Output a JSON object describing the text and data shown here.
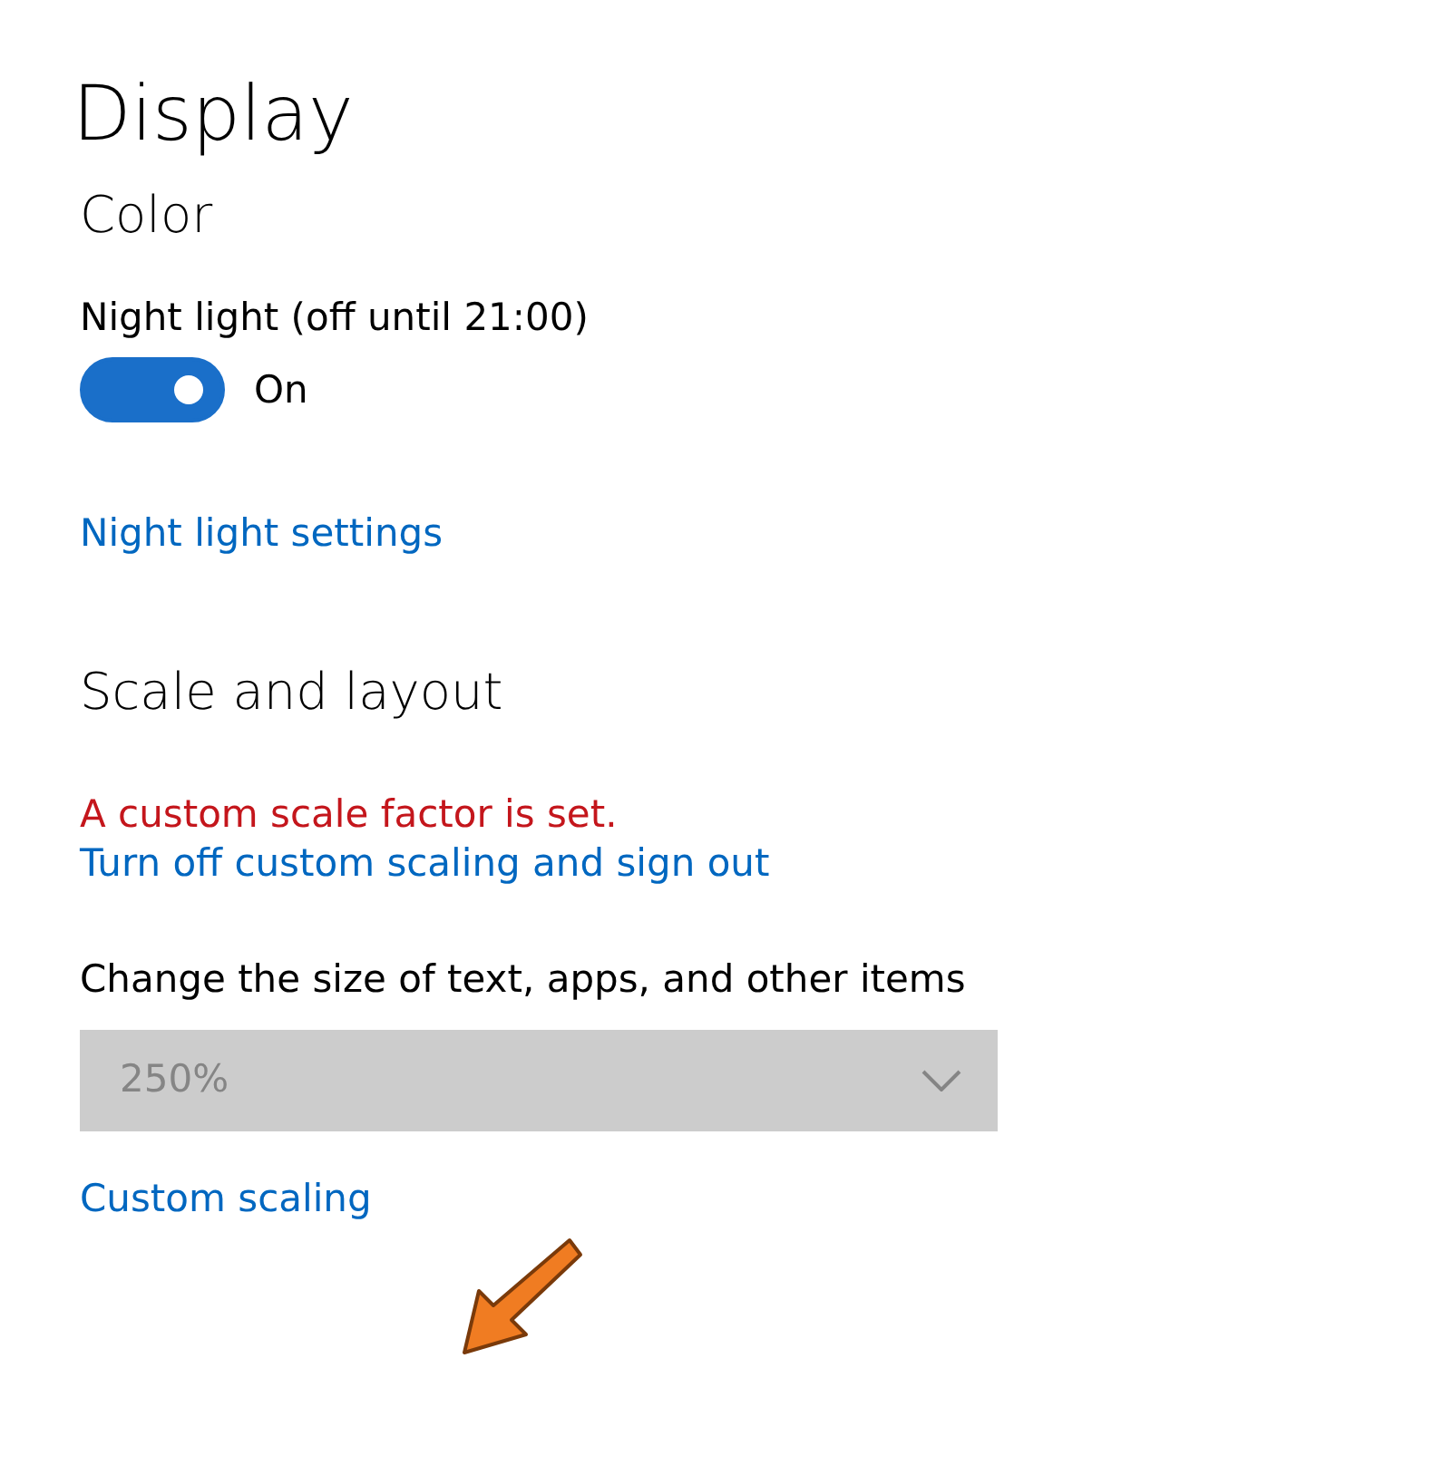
{
  "page_title": "Display",
  "color_section": {
    "heading": "Color",
    "night_light": {
      "label": "Night light (off until 21:00)",
      "on": true,
      "state_text": "On"
    },
    "link": "Night light settings"
  },
  "scale_section": {
    "heading": "Scale and layout",
    "warning": "A custom scale factor is set.",
    "warning_link": "Turn off custom scaling and sign out",
    "size_label": "Change the size of text, apps, and other items",
    "size_dropdown": {
      "value": "250%",
      "disabled": true
    },
    "custom_link": "Custom scaling"
  },
  "annotation": {
    "kind": "arrow",
    "color": "#f07c22"
  }
}
